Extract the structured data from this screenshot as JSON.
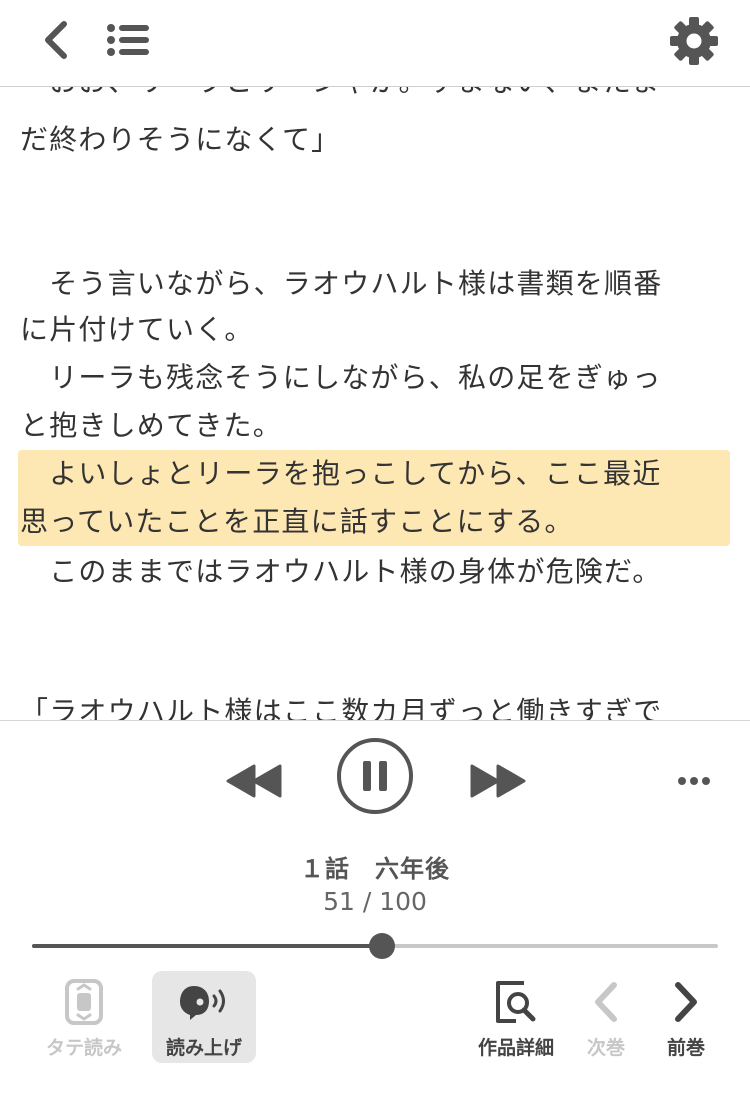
{
  "header": {
    "back_icon": "chevron-left-icon",
    "toc_icon": "list-icon",
    "settings_icon": "gear-icon"
  },
  "reader": {
    "lines": [
      "「おお、リーラとリーシャか。すまない、またま",
      "だ終わりそうになくて」",
      "",
      "",
      "　そう言いながら、ラオウハルト様は書類を順番",
      "に片付けていく。",
      "　リーラも残念そうにしながら、私の足をぎゅっ",
      "と抱きしめてきた。",
      "　よいしょとリーラを抱っこしてから、ここ最近",
      "思っていたことを正直に話すことにする。",
      "　このままではラオウハルト様の身体が危険だ。",
      "",
      "",
      "「ラオウハルト様はここ数カ月ずっと働きすぎで"
    ],
    "highlight_color": "#fde7b3"
  },
  "player": {
    "episode_title": "１話　六年後",
    "page_label": "51 / 100",
    "current_page": 51,
    "total_pages": 100,
    "progress": 0.51,
    "rewind_icon": "rewind-icon",
    "pause_icon": "pause-icon",
    "forward_icon": "fast-forward-icon",
    "more_icon": "more-icon"
  },
  "toolbar": {
    "vertical_label": "タテ読み",
    "read_aloud_label": "読み上げ",
    "detail_label": "作品詳細",
    "next_label": "次巻",
    "prev_label": "前巻"
  },
  "colors": {
    "text": "#333333",
    "accent": "#555555",
    "disabled": "#c7c7c7",
    "highlight": "#fde7b3"
  }
}
